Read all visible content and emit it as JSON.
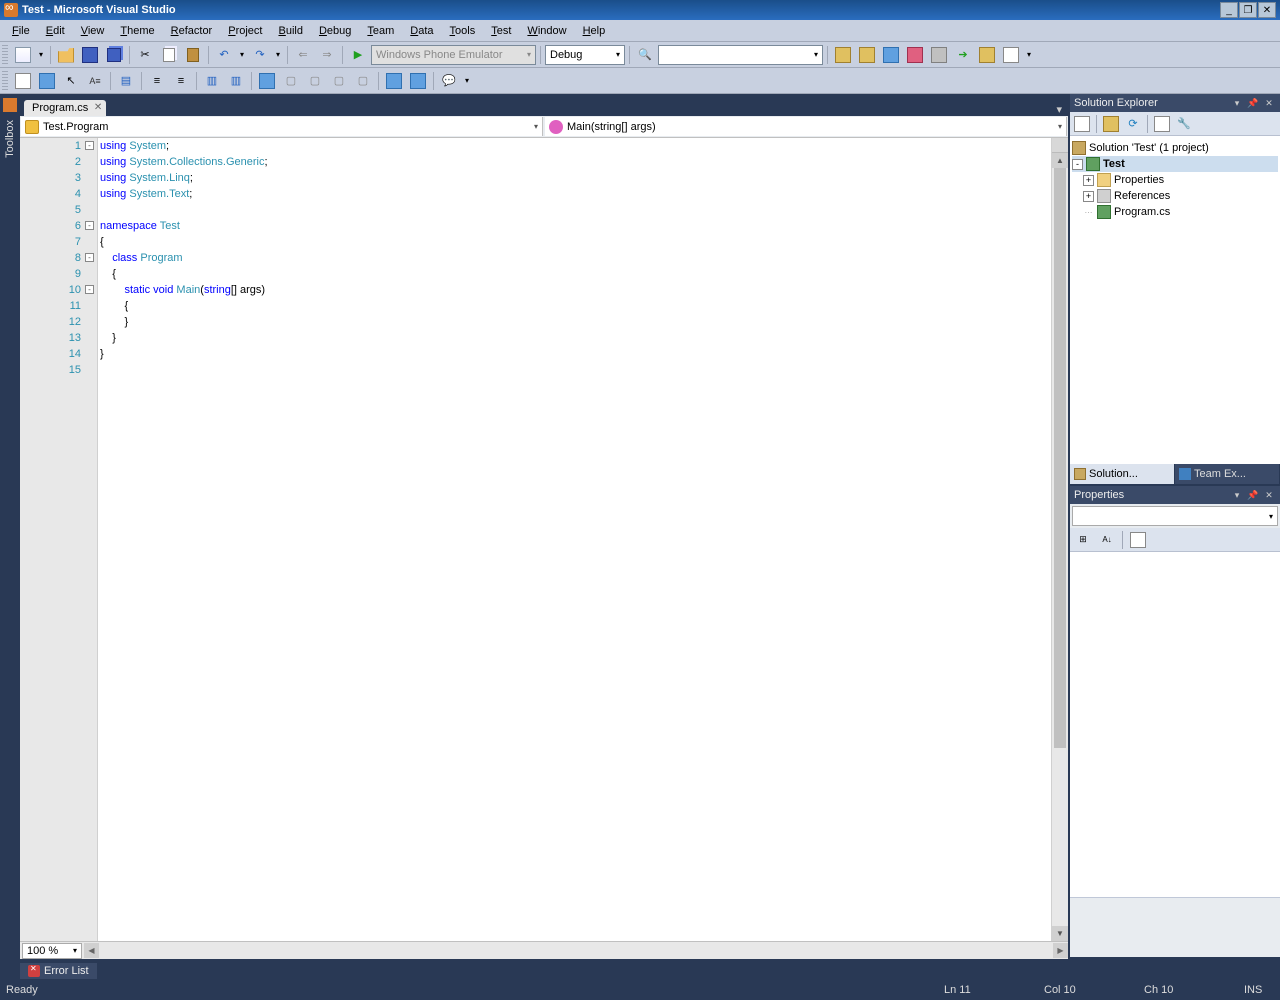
{
  "title": "Test - Microsoft Visual Studio",
  "menus": [
    "File",
    "Edit",
    "View",
    "Theme",
    "Refactor",
    "Project",
    "Build",
    "Debug",
    "Team",
    "Data",
    "Tools",
    "Test",
    "Window",
    "Help"
  ],
  "toolbar": {
    "emulator": "Windows Phone Emulator",
    "config": "Debug"
  },
  "tab": {
    "name": "Program.cs"
  },
  "nav": {
    "class": "Test.Program",
    "member": "Main(string[] args)"
  },
  "code": {
    "lines": [
      {
        "n": 1,
        "tokens": [
          {
            "t": "using ",
            "c": "kw"
          },
          {
            "t": "System",
            "c": "typ"
          },
          {
            "t": ";"
          }
        ]
      },
      {
        "n": 2,
        "tokens": [
          {
            "t": "using ",
            "c": "kw"
          },
          {
            "t": "System.Collections.Generic",
            "c": "typ"
          },
          {
            "t": ";"
          }
        ]
      },
      {
        "n": 3,
        "tokens": [
          {
            "t": "using ",
            "c": "kw"
          },
          {
            "t": "System.Linq",
            "c": "typ"
          },
          {
            "t": ";"
          }
        ]
      },
      {
        "n": 4,
        "tokens": [
          {
            "t": "using ",
            "c": "kw"
          },
          {
            "t": "System.Text",
            "c": "typ"
          },
          {
            "t": ";"
          }
        ]
      },
      {
        "n": 5,
        "tokens": []
      },
      {
        "n": 6,
        "tokens": [
          {
            "t": "namespace ",
            "c": "kw"
          },
          {
            "t": "Test",
            "c": "typ"
          }
        ]
      },
      {
        "n": 7,
        "tokens": [
          {
            "t": "{"
          }
        ]
      },
      {
        "n": 8,
        "tokens": [
          {
            "t": "    "
          },
          {
            "t": "class ",
            "c": "kw"
          },
          {
            "t": "Program",
            "c": "typ"
          }
        ]
      },
      {
        "n": 9,
        "tokens": [
          {
            "t": "    {"
          }
        ]
      },
      {
        "n": 10,
        "tokens": [
          {
            "t": "        "
          },
          {
            "t": "static void ",
            "c": "kw"
          },
          {
            "t": "Main",
            "c": "typ"
          },
          {
            "t": "("
          },
          {
            "t": "string",
            "c": "kw"
          },
          {
            "t": "[] args)"
          }
        ]
      },
      {
        "n": 11,
        "tokens": [
          {
            "t": "        {"
          }
        ]
      },
      {
        "n": 12,
        "tokens": [
          {
            "t": "        }"
          }
        ]
      },
      {
        "n": 13,
        "tokens": [
          {
            "t": "    }"
          }
        ]
      },
      {
        "n": 14,
        "tokens": [
          {
            "t": "}"
          }
        ]
      },
      {
        "n": 15,
        "tokens": []
      }
    ],
    "folds": [
      1,
      6,
      8,
      10
    ]
  },
  "zoom": "100 %",
  "solution_explorer": {
    "title": "Solution Explorer",
    "root": "Solution 'Test' (1 project)",
    "project": "Test",
    "nodes": [
      "Properties",
      "References",
      "Program.cs"
    ]
  },
  "explorer_tabs": {
    "sln": "Solution...",
    "team": "Team Ex..."
  },
  "properties": {
    "title": "Properties"
  },
  "error_list": "Error List",
  "status": {
    "ready": "Ready",
    "ln": "Ln 11",
    "col": "Col 10",
    "ch": "Ch 10",
    "ins": "INS"
  }
}
